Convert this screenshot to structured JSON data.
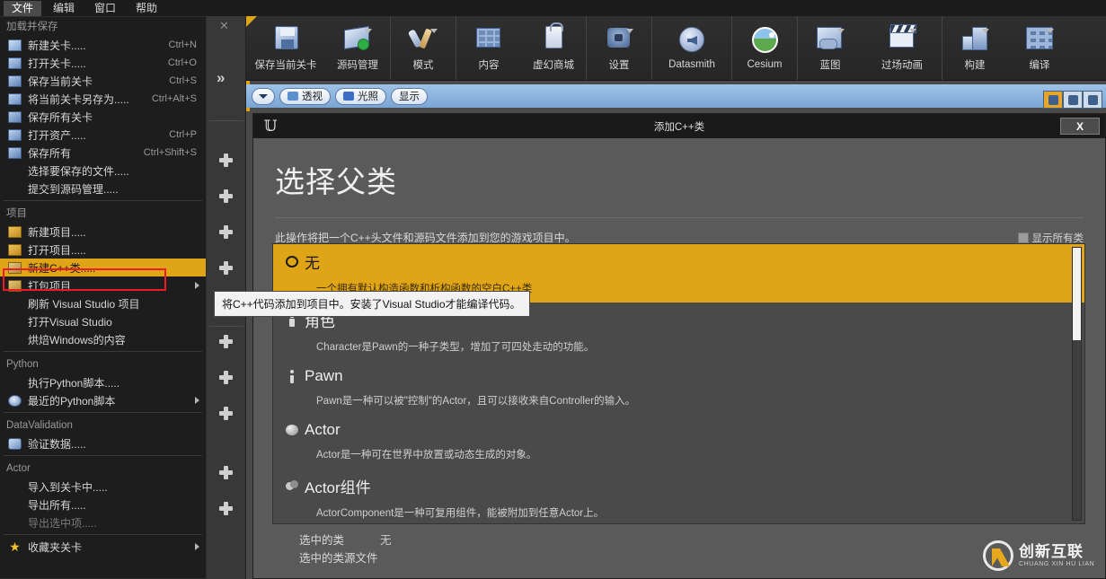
{
  "menubar": {
    "items": [
      {
        "label": "文件",
        "active": true
      },
      {
        "label": "编辑",
        "active": false
      },
      {
        "label": "窗口",
        "active": false
      },
      {
        "label": "帮助",
        "active": false
      }
    ]
  },
  "file_menu": {
    "sections": [
      {
        "header": "加载并保存",
        "items": [
          {
            "label": "新建关卡.....",
            "shortcut": "Ctrl+N",
            "icon": "new-level-icon",
            "icon_class": "ic-doc",
            "state": "normal",
            "submenu": false
          },
          {
            "label": "打开关卡.....",
            "shortcut": "Ctrl+O",
            "icon": "open-level-icon",
            "icon_class": "ic-green",
            "state": "normal",
            "submenu": false
          },
          {
            "label": "保存当前关卡",
            "shortcut": "Ctrl+S",
            "icon": "save-icon",
            "icon_class": "ic-save",
            "state": "normal",
            "submenu": false
          },
          {
            "label": "将当前关卡另存为.....",
            "shortcut": "Ctrl+Alt+S",
            "icon": "save-as-icon",
            "icon_class": "ic-green",
            "state": "normal",
            "submenu": false
          },
          {
            "label": "保存所有关卡",
            "shortcut": "",
            "icon": "save-all-levels-icon",
            "icon_class": "ic-save",
            "state": "normal",
            "submenu": false
          },
          {
            "label": "打开资产.....",
            "shortcut": "Ctrl+P",
            "icon": "open-asset-icon",
            "icon_class": "ic-green",
            "state": "normal",
            "submenu": false
          },
          {
            "label": "保存所有",
            "shortcut": "Ctrl+Shift+S",
            "icon": "save-all-icon",
            "icon_class": "ic-save",
            "state": "normal",
            "submenu": false
          },
          {
            "label": "选择要保存的文件.....",
            "shortcut": "",
            "icon": "",
            "icon_class": "",
            "state": "normal",
            "submenu": false
          },
          {
            "label": "提交到源码管理.....",
            "shortcut": "",
            "icon": "",
            "icon_class": "",
            "state": "normal",
            "submenu": false
          }
        ]
      },
      {
        "header": "项目",
        "items": [
          {
            "label": "新建项目.....",
            "shortcut": "",
            "icon": "new-project-icon",
            "icon_class": "ic-folder",
            "state": "normal",
            "submenu": false
          },
          {
            "label": "打开项目.....",
            "shortcut": "",
            "icon": "open-project-icon",
            "icon_class": "ic-folder",
            "state": "normal",
            "submenu": false
          },
          {
            "label": "新建C++类.....",
            "shortcut": "",
            "icon": "new-cpp-class-icon",
            "icon_class": "ic-cpp",
            "state": "highlight",
            "submenu": false
          },
          {
            "label": "打包项目",
            "shortcut": "",
            "icon": "package-project-icon",
            "icon_class": "ic-box",
            "state": "normal",
            "submenu": true
          },
          {
            "label": "刷新 Visual Studio 项目",
            "shortcut": "",
            "icon": "",
            "icon_class": "",
            "state": "normal",
            "submenu": false
          },
          {
            "label": "打开Visual Studio",
            "shortcut": "",
            "icon": "",
            "icon_class": "",
            "state": "normal",
            "submenu": false
          },
          {
            "label": "烘焙Windows的内容",
            "shortcut": "",
            "icon": "",
            "icon_class": "",
            "state": "normal",
            "submenu": false
          }
        ]
      },
      {
        "header": "Python",
        "items": [
          {
            "label": "执行Python脚本.....",
            "shortcut": "",
            "icon": "",
            "icon_class": "",
            "state": "normal",
            "submenu": false
          },
          {
            "label": "最近的Python脚本",
            "shortcut": "",
            "icon": "recent-python-icon",
            "icon_class": "ic-clock",
            "state": "normal",
            "submenu": true
          }
        ]
      },
      {
        "header": "DataValidation",
        "items": [
          {
            "label": "验证数据.....",
            "shortcut": "",
            "icon": "validate-data-icon",
            "icon_class": "ic-wrench",
            "state": "normal",
            "submenu": false
          }
        ]
      },
      {
        "header": "Actor",
        "items": [
          {
            "label": "导入到关卡中.....",
            "shortcut": "",
            "icon": "",
            "icon_class": "",
            "state": "normal",
            "submenu": false
          },
          {
            "label": "导出所有.....",
            "shortcut": "",
            "icon": "",
            "icon_class": "",
            "state": "normal",
            "submenu": false
          },
          {
            "label": "导出选中项.....",
            "shortcut": "",
            "icon": "",
            "icon_class": "",
            "state": "disabled",
            "submenu": false
          }
        ]
      },
      {
        "header": "",
        "items": [
          {
            "label": "收藏夹关卡",
            "shortcut": "",
            "icon": "favorite-levels-icon",
            "icon_class": "ic-star",
            "state": "normal",
            "submenu": true
          }
        ]
      }
    ]
  },
  "toolbar": {
    "groups": [
      {
        "items": [
          {
            "label": "保存当前关卡",
            "icon": "save-current-level-icon",
            "glyph": "g-floppy",
            "caret": false,
            "wide": true
          },
          {
            "label": "源码管理",
            "icon": "source-control-icon",
            "glyph": "g-source",
            "caret": true,
            "wide": false
          }
        ]
      },
      {
        "items": [
          {
            "label": "模式",
            "icon": "modes-icon",
            "glyph": "g-wrench",
            "caret": true,
            "wide": false
          }
        ]
      },
      {
        "items": [
          {
            "label": "内容",
            "icon": "content-icon",
            "glyph": "g-grid",
            "caret": false,
            "wide": false
          },
          {
            "label": "虚幻商城",
            "icon": "marketplace-icon",
            "glyph": "g-bag",
            "caret": false,
            "wide": false
          }
        ]
      },
      {
        "items": [
          {
            "label": "设置",
            "icon": "settings-icon",
            "glyph": "g-gear",
            "caret": true,
            "wide": false
          }
        ]
      },
      {
        "items": [
          {
            "label": "Datasmith",
            "icon": "datasmith-icon",
            "glyph": "g-speaker",
            "caret": false,
            "wide": true
          }
        ]
      },
      {
        "items": [
          {
            "label": "Cesium",
            "icon": "cesium-icon",
            "glyph": "g-cesium",
            "caret": false,
            "wide": false
          }
        ]
      },
      {
        "items": [
          {
            "label": "蓝图",
            "icon": "blueprints-icon",
            "glyph": "g-bp",
            "caret": true,
            "wide": false
          },
          {
            "label": "过场动画",
            "icon": "cinematics-icon",
            "glyph": "g-clap",
            "caret": true,
            "wide": true
          }
        ]
      },
      {
        "items": [
          {
            "label": "构建",
            "icon": "build-icon",
            "glyph": "g-build",
            "caret": true,
            "wide": false
          },
          {
            "label": "编译",
            "icon": "compile-icon",
            "glyph": "g-compile",
            "caret": true,
            "wide": false
          }
        ]
      }
    ]
  },
  "viewport_toolbar": {
    "buttons": [
      {
        "label": "透视",
        "icon": "perspective-icon",
        "dot_color": "#5c8fd0"
      },
      {
        "label": "光照",
        "icon": "lit-icon",
        "dot_color": "#3f6fc4"
      },
      {
        "label": "显示",
        "icon": "show-icon",
        "dot_color": ""
      }
    ],
    "right_buttons": [
      {
        "icon": "translate-gizmo-icon",
        "active": true
      },
      {
        "icon": "rotate-gizmo-icon",
        "active": false
      },
      {
        "icon": "scale-gizmo-icon",
        "active": false
      }
    ]
  },
  "left_panel": {
    "close_icon": "close-icon",
    "expand_icon": "double-chevron-right-icon",
    "add_buttons": 10
  },
  "dialog": {
    "title": "添加C++类",
    "logo_icon": "unreal-logo-icon",
    "close_label": "X",
    "heading": "选择父类",
    "subtitle": "此操作将把一个C++头文件和源码文件添加到您的游戏项目中。",
    "show_all_label": "显示所有类",
    "show_all_checked": false,
    "classes": [
      {
        "name": "无",
        "desc": "一个拥有默认构造函数和析构函数的空白C++类",
        "icon": "none-class-icon",
        "icon_class": "ci-none",
        "selected": true
      },
      {
        "name": "角色",
        "desc": "Character是Pawn的一种子类型，增加了可四处走动的功能。",
        "icon": "character-class-icon",
        "icon_class": "ci-char",
        "selected": false
      },
      {
        "name": "Pawn",
        "desc": "Pawn是一种可以被\"控制\"的Actor，且可以接收来自Controller的输入。",
        "icon": "pawn-class-icon",
        "icon_class": "ci-pawn",
        "selected": false
      },
      {
        "name": "Actor",
        "desc": "Actor是一种可在世界中放置或动态生成的对象。",
        "icon": "actor-class-icon",
        "icon_class": "ci-actor",
        "selected": false
      },
      {
        "name": "Actor组件",
        "desc": "ActorComponent是一种可复用组件，能被附加到任意Actor上。",
        "icon": "actor-component-class-icon",
        "icon_class": "ci-comp",
        "selected": false
      }
    ],
    "footer": {
      "selected_class_label": "选中的类",
      "selected_class_value": "无",
      "selected_source_label": "选中的类源文件",
      "selected_source_value": ""
    }
  },
  "tooltip": {
    "text": "将C++代码添加到项目中。安装了Visual Studio才能编译代码。"
  },
  "watermark": {
    "cn": "创新互联",
    "en": "CHUANG XIN HU LIAN"
  },
  "colors": {
    "accent_orange": "#e0a516",
    "highlight_red": "#ec1c24",
    "dialog_bg": "#5a5a5a",
    "menu_bg": "#1d1d1d"
  }
}
